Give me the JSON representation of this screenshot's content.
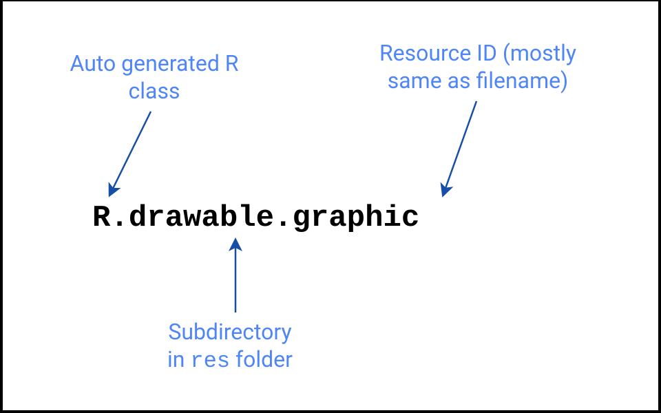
{
  "annotations": {
    "r_class": {
      "line1": "Auto generated R",
      "line2": "class"
    },
    "resource_id": {
      "line1": "Resource ID (mostly",
      "line2": "same as filename)"
    },
    "subdir": {
      "line1": "Subdirectory",
      "line2_prefix": "in ",
      "line2_code": "res",
      "line2_suffix": " folder"
    }
  },
  "code": {
    "r": "R",
    "sep1": ".",
    "drawable": "drawable",
    "sep2": ".",
    "graphic": "graphic"
  },
  "colors": {
    "annotation": "#4f86f7",
    "arrow": "#174ea6",
    "code": "#000000"
  }
}
